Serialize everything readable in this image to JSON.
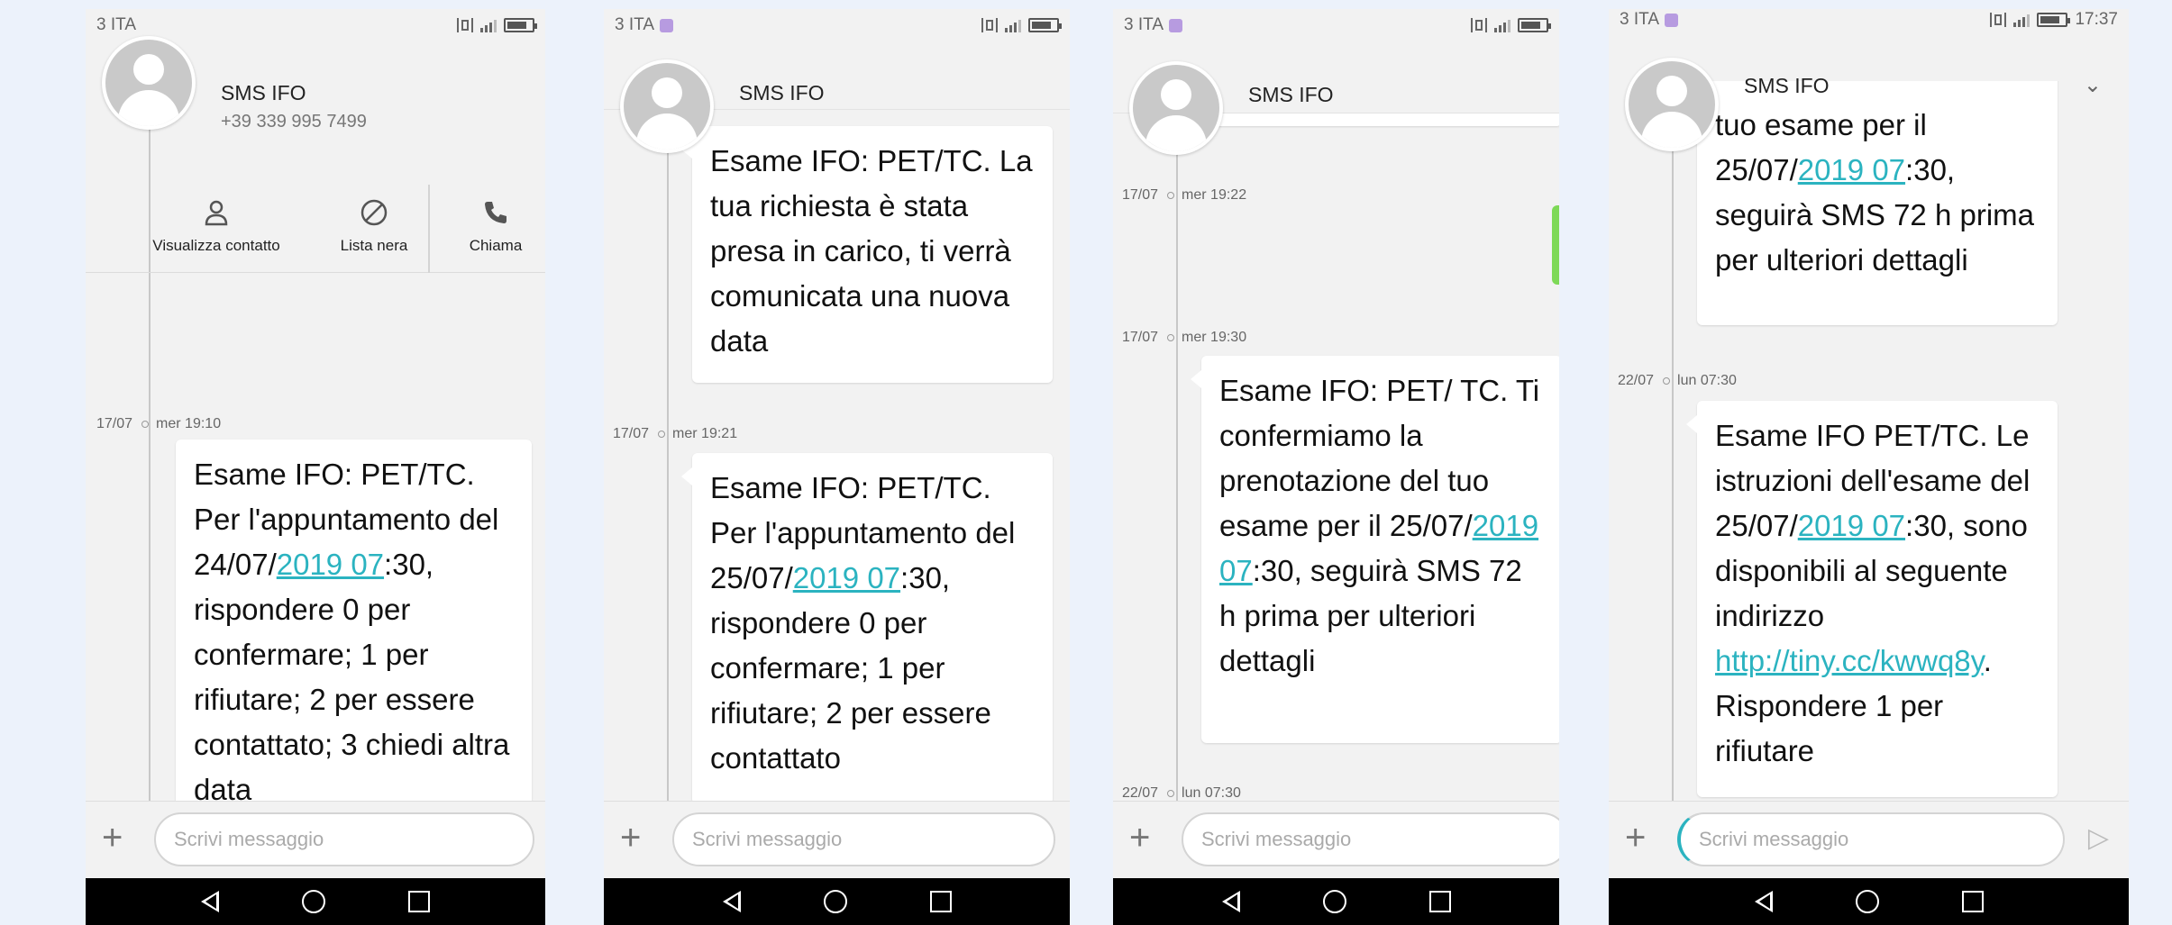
{
  "colors": {
    "link": "#2bb3c0",
    "badge": "#b79be0",
    "background": "#ecf2fb"
  },
  "compose_placeholder": "Scrivi messaggio",
  "contact_number": "+39 339 995 7499",
  "screens": [
    {
      "carrier": "3 ITA",
      "contact": "SMS IFO",
      "actions": [
        {
          "label": "Visualizza contatto",
          "icon": "person-icon"
        },
        {
          "label": "Lista nera",
          "icon": "block-icon"
        },
        {
          "label": "Chiama",
          "icon": "phone-icon"
        }
      ],
      "timestamp": {
        "date": "17/07",
        "time": "mer 19:10"
      },
      "message": {
        "pre": "Esame IFO: PET/TC. Per l'appuntamento del 24/07/",
        "link": "2019 07",
        "post": ":30, rispondere 0 per confermare; 1 per rifiutare; 2 per essere contattato; 3 chiedi altra data"
      }
    },
    {
      "carrier": "3 ITA",
      "contact": "SMS IFO",
      "message_a": "Esame IFO: PET/TC. La tua richiesta è stata presa in carico, ti verrà comunicata una nuova data",
      "timestamp": {
        "date": "17/07",
        "time": "mer 19:21"
      },
      "message_b": {
        "pre": "Esame IFO: PET/TC. Per l'appuntamento del 25/07/",
        "link": "2019 07",
        "post": ":30, rispondere 0 per confermare; 1 per rifiutare; 2 per essere contattato"
      }
    },
    {
      "carrier": "3 ITA",
      "contact": "SMS IFO",
      "timestamp_a": {
        "date": "17/07",
        "time": "mer 19:22"
      },
      "timestamp_b": {
        "date": "17/07",
        "time": "mer 19:30"
      },
      "message": {
        "pre": "Esame IFO: PET/ TC. Ti confermiamo la prenotazione del tuo esame per il 25/07/",
        "link": "2019 07",
        "post": ":30, seguirà SMS 72 h prima per ulteriori dettagli"
      },
      "timestamp_c": {
        "date": "22/07",
        "time": "lun 07:30"
      }
    },
    {
      "carrier": "3 ITA",
      "clock": "17:37",
      "contact": "SMS IFO",
      "message_a": {
        "pre": "tuo esame per il 25/07/",
        "link": "2019 07",
        "post": ":30, seguirà SMS 72 h prima per ulteriori dettagli"
      },
      "timestamp": {
        "date": "22/07",
        "time": "lun 07:30"
      },
      "message_b": {
        "pre": "Esame IFO PET/TC. Le istruzioni dell'esame del 25/07/",
        "link": "2019 07",
        "mid": ":30, sono disponibili al seguente indirizzo ",
        "url": "http://tiny.cc/kwwq8y",
        "post": ". Rispondere 1 per rifiutare"
      }
    }
  ]
}
